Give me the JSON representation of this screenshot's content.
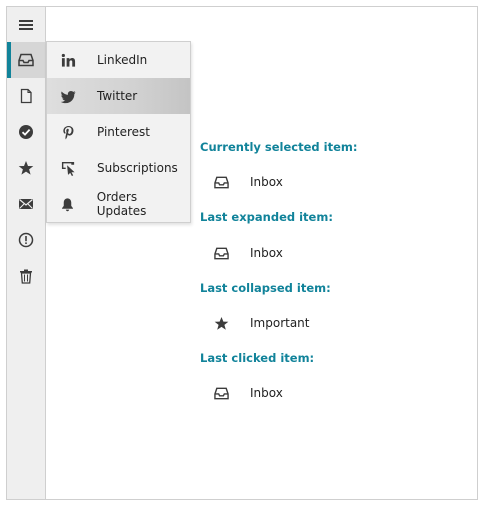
{
  "colors": {
    "accent": "#11839a",
    "rail_bg": "#efefef",
    "popup_bg": "#f2f2f2",
    "icon": "#3c3c3c"
  },
  "rail": {
    "items": [
      {
        "icon": "hamburger-menu-icon",
        "active": false
      },
      {
        "icon": "inbox-icon",
        "active": true
      },
      {
        "icon": "document-icon",
        "active": false
      },
      {
        "icon": "check-circle-icon",
        "active": false
      },
      {
        "icon": "star-icon",
        "active": false
      },
      {
        "icon": "envelope-icon",
        "active": false
      },
      {
        "icon": "exclamation-circle-icon",
        "active": false
      },
      {
        "icon": "trash-icon",
        "active": false
      }
    ]
  },
  "popup": {
    "items": [
      {
        "label": "LinkedIn",
        "icon": "linkedin-icon"
      },
      {
        "label": "Twitter",
        "icon": "twitter-icon",
        "hovered": true
      },
      {
        "label": "Pinterest",
        "icon": "pinterest-icon"
      },
      {
        "label": "Subscriptions",
        "icon": "cursor-click-icon"
      },
      {
        "label": "Orders Updates",
        "icon": "bell-icon"
      }
    ]
  },
  "info": {
    "selected": {
      "heading": "Currently selected item:",
      "value": "Inbox",
      "icon": "inbox-icon"
    },
    "expanded": {
      "heading": "Last expanded item:",
      "value": "Inbox",
      "icon": "inbox-icon"
    },
    "collapsed": {
      "heading": "Last collapsed item:",
      "value": "Important",
      "icon": "star-icon"
    },
    "clicked": {
      "heading": "Last clicked item:",
      "value": "Inbox",
      "icon": "inbox-icon"
    }
  }
}
